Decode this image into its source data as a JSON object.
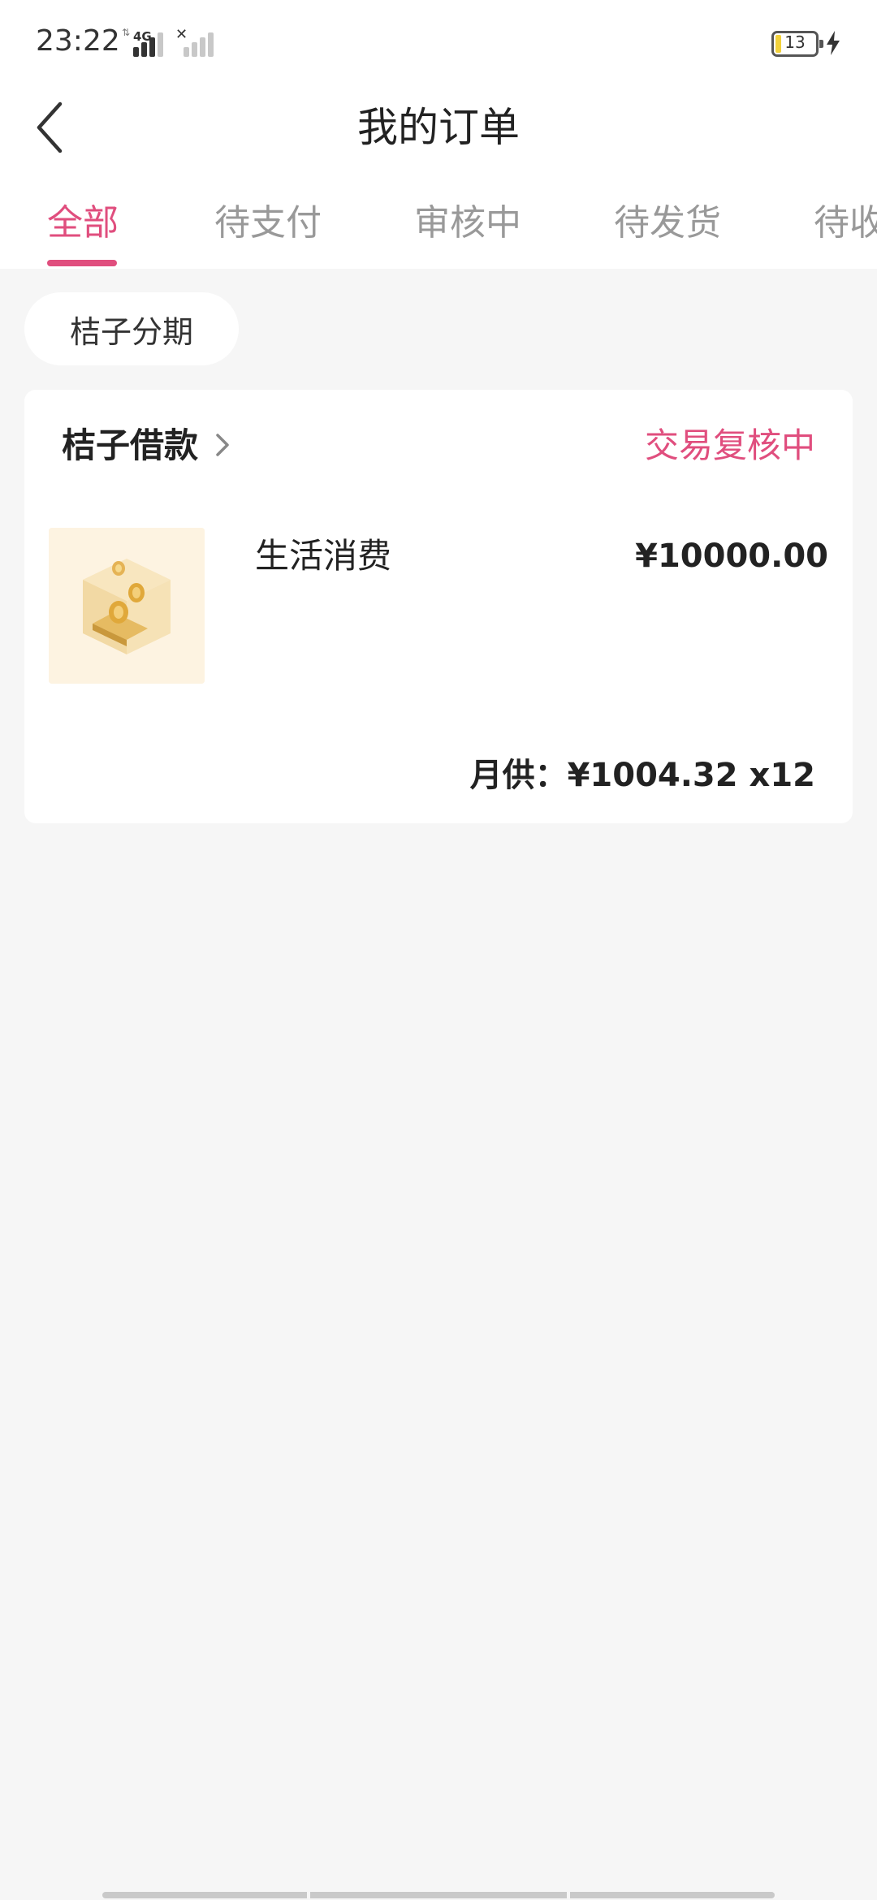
{
  "status_bar": {
    "time": "23:22",
    "network": "4G",
    "battery": "13",
    "icons": [
      "signal-4g-icon",
      "signal-no-sim-icon",
      "battery-icon",
      "charging-icon"
    ]
  },
  "header": {
    "title": "我的订单",
    "back_icon": "chevron-left-icon"
  },
  "tabs": [
    {
      "label": "全部",
      "active": true
    },
    {
      "label": "待支付",
      "active": false
    },
    {
      "label": "审核中",
      "active": false
    },
    {
      "label": "待发货",
      "active": false
    },
    {
      "label": "待收",
      "active": false
    }
  ],
  "filter": {
    "label": "桔子分期"
  },
  "order": {
    "merchant": "桔子借款",
    "status": "交易复核中",
    "product_name": "生活消费",
    "price": "¥10000.00",
    "installment": "月供：¥1004.32 x12"
  },
  "colors": {
    "accent": "#e04e7e",
    "background": "#f6f6f6",
    "card": "#ffffff",
    "text": "#222222",
    "muted": "#999999"
  }
}
